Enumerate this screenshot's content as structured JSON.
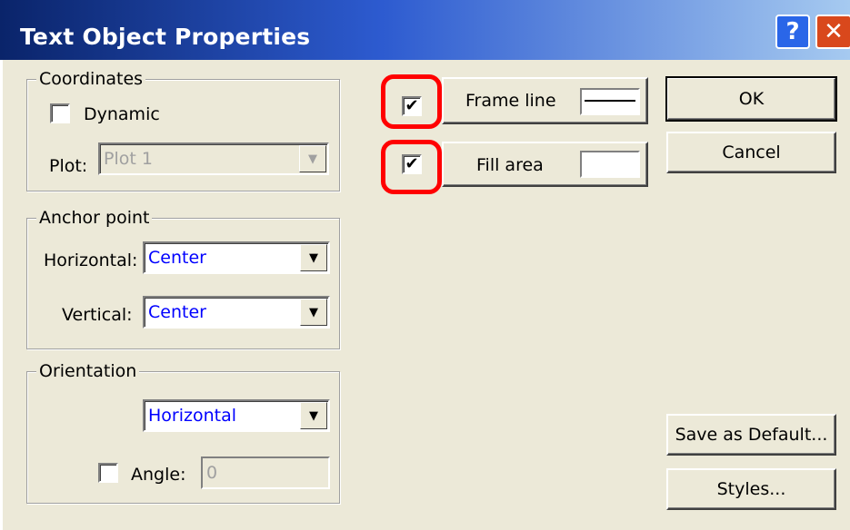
{
  "window": {
    "title": "Text Object Properties",
    "help_glyph": "?",
    "close_glyph": "✕"
  },
  "coordinates": {
    "legend": "Coordinates",
    "dynamic_label": "Dynamic",
    "dynamic_checked": false,
    "plot_label": "Plot:",
    "plot_value": "Plot 1"
  },
  "anchor_point": {
    "legend": "Anchor point",
    "horizontal_label": "Horizontal:",
    "horizontal_value": "Center",
    "vertical_label": "Vertical:",
    "vertical_value": "Center"
  },
  "orientation": {
    "legend": "Orientation",
    "value": "Horizontal",
    "angle_label": "Angle:",
    "angle_checked": false,
    "angle_value": "0"
  },
  "frame_line": {
    "label": "Frame line",
    "checked": true,
    "check_glyph": "✔"
  },
  "fill_area": {
    "label": "Fill area",
    "checked": true,
    "check_glyph": "✔"
  },
  "buttons": {
    "ok": "OK",
    "cancel": "Cancel",
    "save_default": "Save as Default...",
    "styles": "Styles..."
  },
  "arrow_glyph": "▼",
  "colors": {
    "highlight": "#ff0000",
    "combo_text": "#0000ff"
  }
}
